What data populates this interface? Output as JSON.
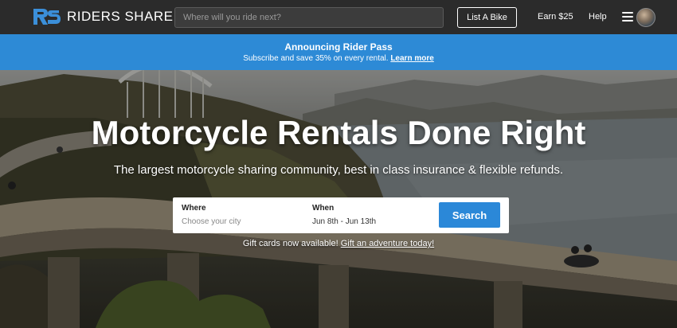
{
  "header": {
    "brand": "RIDERS SHARE",
    "search_placeholder": "Where will you ride next?",
    "list_bike_label": "List A Bike",
    "earn_label": "Earn $25",
    "help_label": "Help"
  },
  "banner": {
    "title": "Announcing Rider Pass",
    "subtitle": "Subscribe and save 35% on every rental.",
    "link": "Learn more"
  },
  "hero": {
    "title": "Motorcycle Rentals Done Right",
    "subtitle": "The largest motorcycle sharing community, best in class insurance & flexible refunds.",
    "where_label": "Where",
    "where_placeholder": "Choose your city",
    "when_label": "When",
    "when_value": "Jun 8th - Jun 13th",
    "search_label": "Search",
    "gift_text": "Gift cards now available!",
    "gift_link": "Gift an adventure today!"
  },
  "colors": {
    "header_bg": "#2b2b2b",
    "banner_bg": "#2d8ad6",
    "accent": "#2b88d8"
  }
}
